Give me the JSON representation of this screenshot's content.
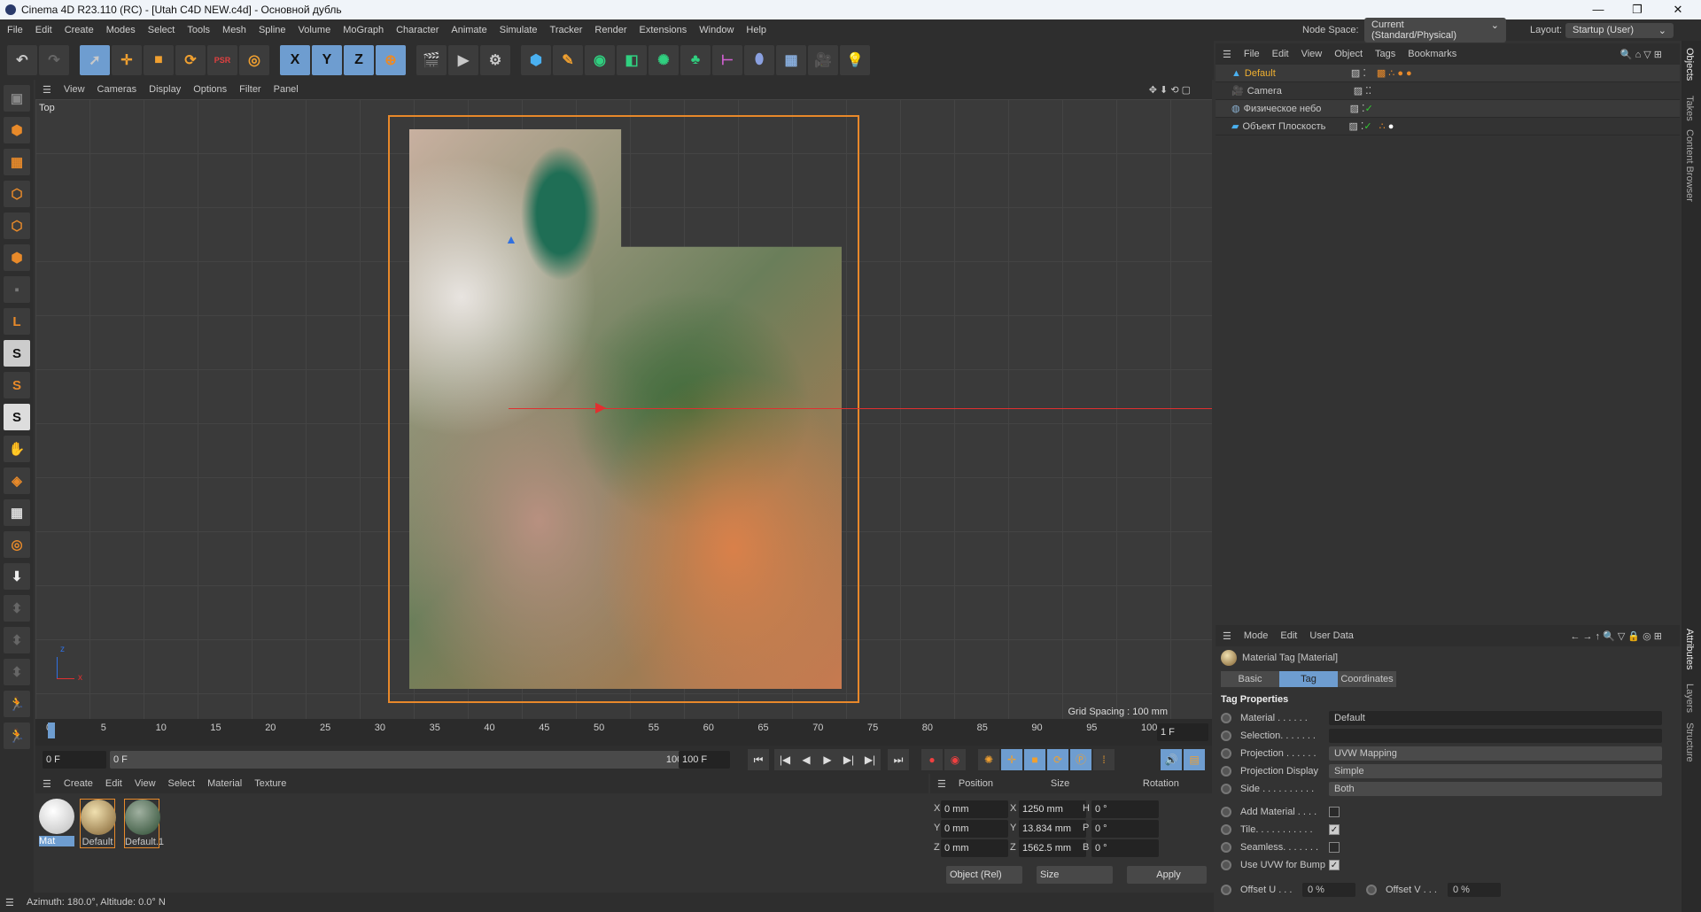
{
  "window": {
    "title": "Cinema 4D R23.110 (RC) - [Utah C4D NEW.c4d] - Основной дубль",
    "minimize": "—",
    "maximize": "❐",
    "close": "✕"
  },
  "menu": [
    "File",
    "Edit",
    "Create",
    "Modes",
    "Select",
    "Tools",
    "Mesh",
    "Spline",
    "Volume",
    "MoGraph",
    "Character",
    "Animate",
    "Simulate",
    "Tracker",
    "Render",
    "Extensions",
    "Window",
    "Help"
  ],
  "node_space": {
    "label": "Node Space:",
    "value": "Current (Standard/Physical)"
  },
  "layout": {
    "label": "Layout:",
    "value": "Startup (User)"
  },
  "toolbar": {
    "x": "X",
    "y": "Y",
    "z": "Z"
  },
  "viewport": {
    "menu": [
      "View",
      "Cameras",
      "Display",
      "Options",
      "Filter",
      "Panel"
    ],
    "view_name": "Top",
    "grid_spacing": "Grid Spacing : 100 mm",
    "axis_x": "x",
    "axis_z": "z"
  },
  "timeline": {
    "ticks": [
      "0",
      "5",
      "10",
      "15",
      "20",
      "25",
      "30",
      "35",
      "40",
      "45",
      "50",
      "55",
      "60",
      "65",
      "70",
      "75",
      "80",
      "85",
      "90",
      "95",
      "100"
    ],
    "current": "1 F",
    "start": "0 F",
    "range_start": "0 F",
    "range_end": "100 F",
    "end": "100 F"
  },
  "material_manager": {
    "menu": [
      "Create",
      "Edit",
      "View",
      "Select",
      "Material",
      "Texture"
    ],
    "materials": [
      {
        "name": "Mat",
        "color": "#f0f0f0"
      },
      {
        "name": "Default",
        "color": "#c8a060"
      },
      {
        "name": "Default.1",
        "color": "#4a6a50"
      }
    ]
  },
  "coordinates": {
    "headers": [
      "Position",
      "Size",
      "Rotation"
    ],
    "rows": [
      {
        "axis": "X",
        "pos": "0 mm",
        "size_axis": "X",
        "size": "1250 mm",
        "rot_axis": "H",
        "rot": "0 °"
      },
      {
        "axis": "Y",
        "pos": "0 mm",
        "size_axis": "Y",
        "size": "13.834 mm",
        "rot_axis": "P",
        "rot": "0 °"
      },
      {
        "axis": "Z",
        "pos": "0 mm",
        "size_axis": "Z",
        "size": "1562.5 mm",
        "rot_axis": "B",
        "rot": "0 °"
      }
    ],
    "mode": "Object (Rel)",
    "size_mode": "Size",
    "apply": "Apply"
  },
  "status": "Azimuth: 180.0°, Altitude: 0.0°  N",
  "objects": {
    "menu": [
      "File",
      "Edit",
      "View",
      "Object",
      "Tags",
      "Bookmarks"
    ],
    "items": [
      {
        "name": "Default",
        "color": "#f0b030"
      },
      {
        "name": "Camera",
        "color": "#ddd"
      },
      {
        "name": "Физическое небо",
        "color": "#ddd"
      },
      {
        "name": "Объект Плоскость",
        "color": "#ddd"
      }
    ]
  },
  "attributes": {
    "menu": [
      "Mode",
      "Edit",
      "User Data"
    ],
    "title": "Material Tag [Material]",
    "tabs": [
      "Basic",
      "Tag",
      "Coordinates"
    ],
    "section": "Tag Properties",
    "material": {
      "label": "Material . . . . . .",
      "value": "Default"
    },
    "selection": {
      "label": "Selection. . . . . . .",
      "value": ""
    },
    "projection": {
      "label": "Projection . . . . . .",
      "value": "UVW Mapping"
    },
    "projection_display": {
      "label": "Projection Display",
      "value": "Simple"
    },
    "side": {
      "label": "Side . . . . . . . . . .",
      "value": "Both"
    },
    "add_material": {
      "label": "Add Material . . . .",
      "checked": false
    },
    "tile": {
      "label": "Tile. . . . . . . . . . .",
      "checked": true
    },
    "seamless": {
      "label": "Seamless. . . . . . .",
      "checked": false
    },
    "use_uvw_bump": {
      "label": "Use UVW for Bump",
      "checked": true
    },
    "offset_u": {
      "label": "Offset U . . .",
      "value": "0 %"
    },
    "offset_v": {
      "label": "Offset V . . .",
      "value": "0 %"
    }
  },
  "side_tabs": [
    "Objects",
    "Takes",
    "Content Browser",
    "Attributes",
    "Layers",
    "Structure"
  ]
}
